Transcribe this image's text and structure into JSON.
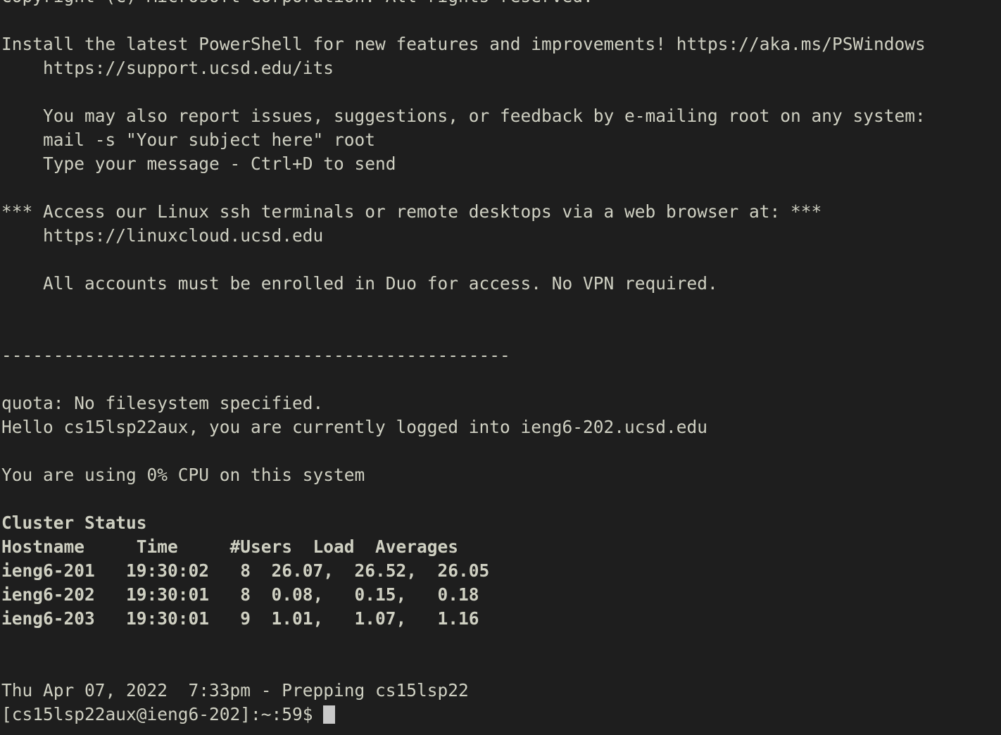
{
  "terminal": {
    "window_role": "ssh-terminal-session",
    "background_color": "#1e1e1e",
    "foreground_color": "#cfd0c2",
    "cursor_color": "#c9c9c9",
    "font_size_px": 24,
    "line_height_px": 34,
    "columns_visible": 85,
    "lines": [
      {
        "id": "copyright",
        "text": "Copyright (C) Microsoft Corporation. All rights reserved.",
        "bold": false,
        "clipped": true
      },
      {
        "id": "blank-1",
        "text": "",
        "bold": false
      },
      {
        "id": "ps-install",
        "text": "Install the latest PowerShell for new features and improvements! https://aka.ms/PSWindows",
        "bold": false
      },
      {
        "id": "support-url",
        "text": "    https://support.ucsd.edu/its",
        "bold": false
      },
      {
        "id": "blank-2",
        "text": "",
        "bold": false
      },
      {
        "id": "report-issues",
        "text": "    You may also report issues, suggestions, or feedback by e-mailing root on any system:",
        "bold": false
      },
      {
        "id": "mail-command",
        "text": "    mail -s \"Your subject here\" root",
        "bold": false
      },
      {
        "id": "mail-hint",
        "text": "    Type your message - Ctrl+D to send",
        "bold": false
      },
      {
        "id": "blank-3",
        "text": "",
        "bold": false
      },
      {
        "id": "access-banner",
        "text": "*** Access our Linux ssh terminals or remote desktops via a web browser at: ***",
        "bold": false
      },
      {
        "id": "linuxcloud-url",
        "text": "    https://linuxcloud.ucsd.edu",
        "bold": false
      },
      {
        "id": "blank-4",
        "text": "",
        "bold": false
      },
      {
        "id": "duo-notice",
        "text": "    All accounts must be enrolled in Duo for access. No VPN required.",
        "bold": false
      },
      {
        "id": "blank-5",
        "text": "",
        "bold": false
      },
      {
        "id": "blank-6",
        "text": "",
        "bold": false
      },
      {
        "id": "separator",
        "text": "-------------------------------------------------",
        "bold": false
      },
      {
        "id": "blank-7",
        "text": "",
        "bold": false
      },
      {
        "id": "quota-msg",
        "text": "quota: No filesystem specified.",
        "bold": false
      },
      {
        "id": "hello-msg",
        "text": "Hello cs15lsp22aux, you are currently logged into ieng6-202.ucsd.edu",
        "bold": false
      },
      {
        "id": "blank-8",
        "text": "",
        "bold": false
      },
      {
        "id": "cpu-usage",
        "text": "You are using 0% CPU on this system",
        "bold": false
      },
      {
        "id": "blank-9",
        "text": "",
        "bold": false
      },
      {
        "id": "cluster-status-title",
        "text": "Cluster Status",
        "bold": true
      },
      {
        "id": "cluster-table-header",
        "text": "Hostname     Time     #Users  Load  Averages",
        "bold": true
      },
      {
        "id": "cluster-row-201",
        "text": "ieng6-201   19:30:02   8  26.07,  26.52,  26.05",
        "bold": true
      },
      {
        "id": "cluster-row-202",
        "text": "ieng6-202   19:30:01   8  0.08,   0.15,   0.18",
        "bold": true
      },
      {
        "id": "cluster-row-203",
        "text": "ieng6-203   19:30:01   9  1.01,   1.07,   1.16",
        "bold": true
      },
      {
        "id": "blank-10",
        "text": "",
        "bold": false
      },
      {
        "id": "blank-11",
        "text": "",
        "bold": false
      },
      {
        "id": "motd-date",
        "text": "Thu Apr 07, 2022  7:33pm - Prepping cs15lsp22",
        "bold": false
      },
      {
        "id": "prompt",
        "text": "[cs15lsp22aux@ieng6-202]:~:59$ ",
        "bold": false,
        "cursor": true
      }
    ],
    "cluster_status": {
      "title": "Cluster Status",
      "columns": [
        "Hostname",
        "Time",
        "#Users",
        "Load",
        "Averages"
      ],
      "rows": [
        {
          "hostname": "ieng6-201",
          "time": "19:30:02",
          "users": "8",
          "load1": "26.07,",
          "load5": "26.52,",
          "load15": "26.05"
        },
        {
          "hostname": "ieng6-202",
          "time": "19:30:01",
          "users": "8",
          "load1": "0.08,",
          "load5": "0.15,",
          "load15": "0.18"
        },
        {
          "hostname": "ieng6-203",
          "time": "19:30:01",
          "users": "9",
          "load1": "1.01,",
          "load5": "1.07,",
          "load15": "1.16"
        }
      ]
    },
    "session": {
      "user": "cs15lsp22aux",
      "host": "ieng6-202",
      "full_host": "ieng6-202.ucsd.edu",
      "cwd": "~",
      "history_number": "59",
      "prompt_symbol": "$",
      "cpu_usage": "0%",
      "date_line": "Thu Apr 07, 2022  7:33pm - Prepping cs15lsp22"
    },
    "urls": {
      "powershell": "https://aka.ms/PSWindows",
      "support": "https://support.ucsd.edu/its",
      "linuxcloud": "https://linuxcloud.ucsd.edu"
    }
  }
}
